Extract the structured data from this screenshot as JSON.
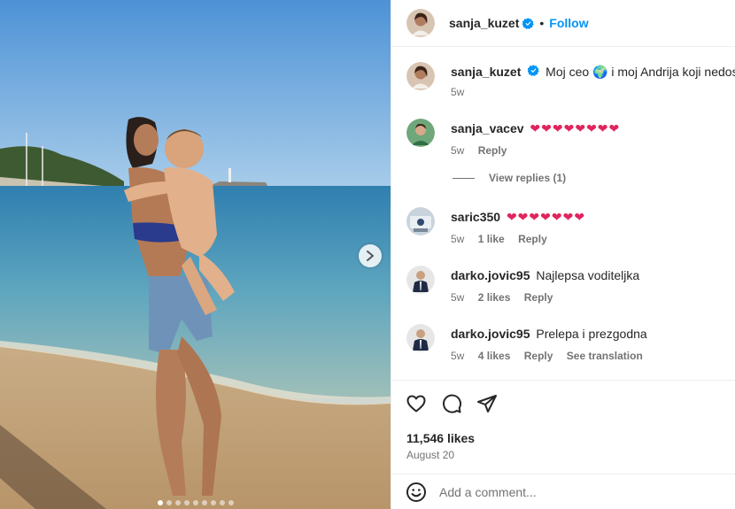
{
  "post": {
    "author": "sanja_kuzet",
    "follow_label": "Follow",
    "separator": "•",
    "caption_text": "Moj ceo 🌍 i moj Andrija koji nedostaje",
    "caption_time": "5w",
    "likes": "11,546 likes",
    "date": "August 20",
    "carousel_total": 9,
    "carousel_active": 1
  },
  "comments": [
    {
      "user": "sanja_vacev",
      "text": "❤❤❤❤❤❤❤❤",
      "time": "5w",
      "likes": "",
      "reply": "Reply",
      "translation": ""
    },
    {
      "user": "saric350",
      "text": "❤❤❤❤❤❤❤",
      "time": "5w",
      "likes": "1 like",
      "reply": "Reply",
      "translation": ""
    },
    {
      "user": "darko.jovic95",
      "text": "Najlepsa voditeljka",
      "time": "5w",
      "likes": "2 likes",
      "reply": "Reply",
      "translation": ""
    },
    {
      "user": "darko.jovic95",
      "text": "Prelepa i prezgodna",
      "time": "5w",
      "likes": "4 likes",
      "reply": "Reply",
      "translation": "See translation"
    }
  ],
  "view_replies": "View replies (1)",
  "add_comment": {
    "placeholder": "Add a comment..."
  },
  "icons": {
    "like": "heart-icon",
    "comment": "comment-icon",
    "share": "share-icon",
    "emoji": "emoji-icon",
    "verified": "verified-badge-icon",
    "next": "chevron-right-icon"
  },
  "colors": {
    "link": "#0095f6",
    "verified": "#0095f6",
    "text": "#262626",
    "muted": "#737373",
    "heart": "#ed4956"
  }
}
